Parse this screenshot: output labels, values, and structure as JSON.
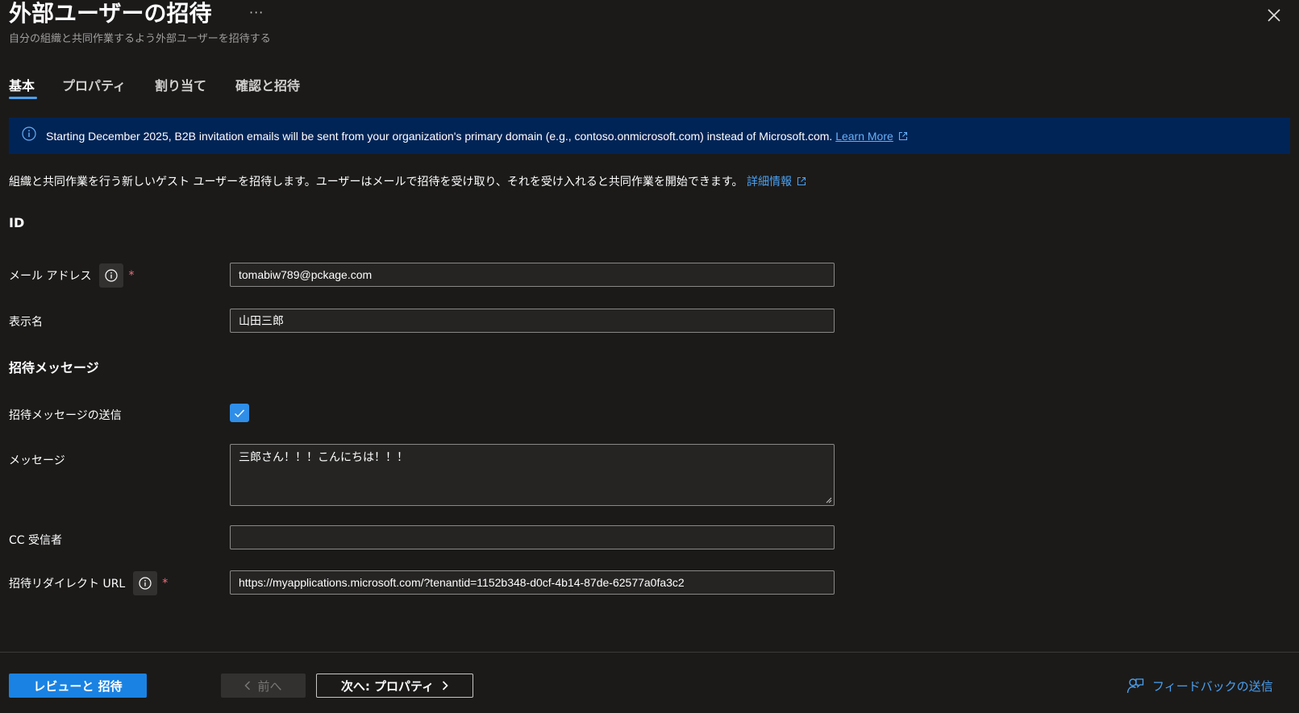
{
  "header": {
    "title": "外部ユーザーの招待",
    "more_label": "···",
    "subtitle": "自分の組織と共同作業するよう外部ユーザーを招待する"
  },
  "tabs": [
    {
      "label": "基本",
      "active": true
    },
    {
      "label": "プロパティ",
      "active": false
    },
    {
      "label": "割り当て",
      "active": false
    },
    {
      "label": "確認と招待",
      "active": false
    }
  ],
  "banner": {
    "text": "Starting December 2025, B2B invitation emails will be sent from your organization's primary domain (e.g., contoso.onmicrosoft.com) instead of Microsoft.com.",
    "link": "Learn More"
  },
  "description": {
    "text": "組織と共同作業を行う新しいゲスト ユーザーを招待します。ユーザーはメールで招待を受け取り、それを受け入れると共同作業を開始できます。",
    "link": "詳細情報"
  },
  "sections": {
    "identity": "ID",
    "invite_message": "招待メッセージ"
  },
  "form": {
    "email": {
      "label": "メール アドレス",
      "value": "tomabiw789@pckage.com",
      "required_mark": "*"
    },
    "display_name": {
      "label": "表示名",
      "value": "山田三郎"
    },
    "send_message": {
      "label": "招待メッセージの送信",
      "checked": true
    },
    "message": {
      "label": "メッセージ",
      "value": "三郎さん！！！こんにちは！！！"
    },
    "cc": {
      "label": "CC 受信者",
      "value": ""
    },
    "redirect_url": {
      "label": "招待リダイレクト URL",
      "value": "https://myapplications.microsoft.com/?tenantid=1152b348-d0cf-4b14-87de-62577a0fa3c2",
      "required_mark": "*"
    }
  },
  "footer": {
    "review_label": "レビューと 招待",
    "prev_label": "前へ",
    "next_label": "次へ: プロパティ",
    "feedback_label": "フィードバックの送信"
  },
  "colors": {
    "background": "#1b1a19",
    "accent": "#1a82e2",
    "banner": "#012456",
    "link": "#4aa0f0"
  }
}
